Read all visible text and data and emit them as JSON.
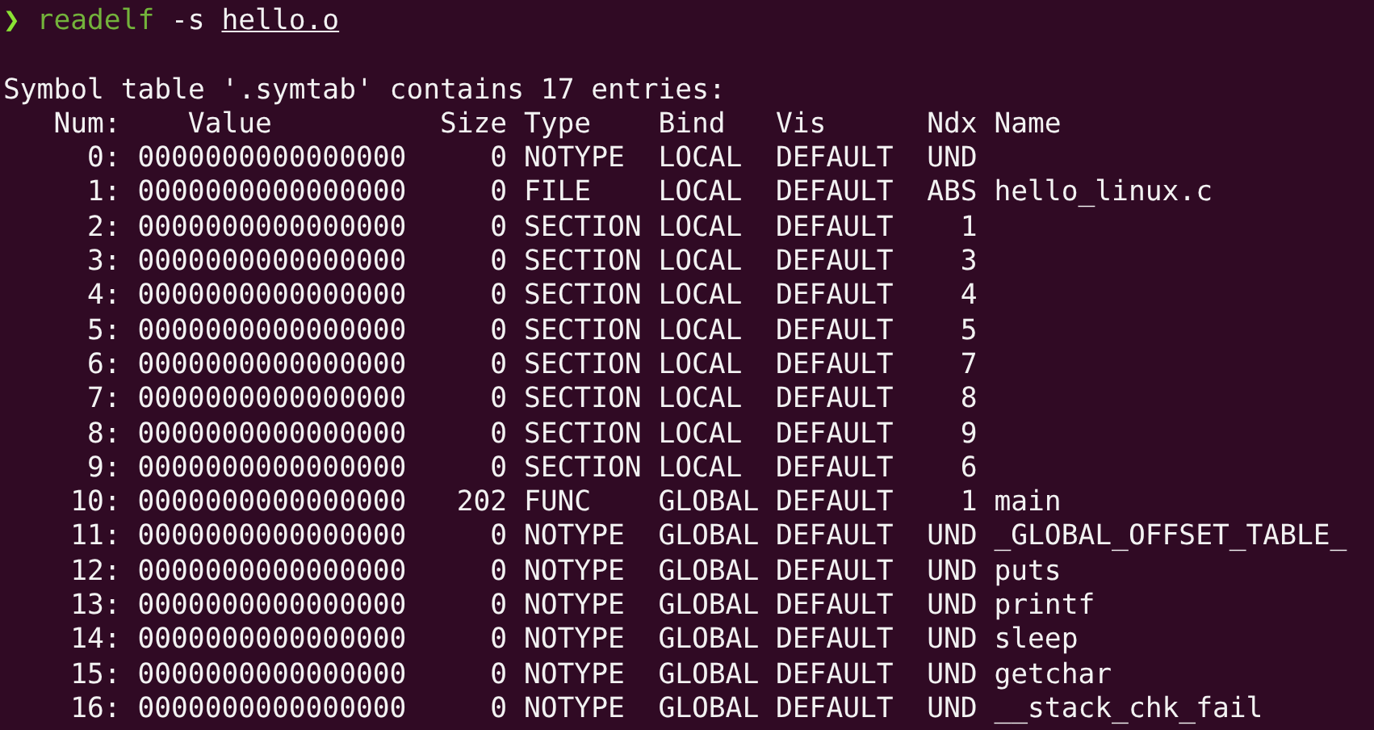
{
  "prompt": {
    "symbol": "❯",
    "command": "readelf",
    "flag": "-s",
    "file": "hello.o"
  },
  "summary": "Symbol table '.symtab' contains 17 entries:",
  "table": {
    "columns": [
      "Num:",
      "Value",
      "Size",
      "Type",
      "Bind",
      "Vis",
      "Ndx",
      "Name"
    ],
    "rows": [
      {
        "num": "0:",
        "value": "0000000000000000",
        "size": "0",
        "type": "NOTYPE",
        "bind": "LOCAL",
        "vis": "DEFAULT",
        "ndx": "UND"
      },
      {
        "num": "1:",
        "value": "0000000000000000",
        "size": "0",
        "type": "FILE",
        "bind": "LOCAL",
        "vis": "DEFAULT",
        "ndx": "ABS",
        "name": "hello_linux.c"
      },
      {
        "num": "2:",
        "value": "0000000000000000",
        "size": "0",
        "type": "SECTION",
        "bind": "LOCAL",
        "vis": "DEFAULT",
        "ndx": "1"
      },
      {
        "num": "3:",
        "value": "0000000000000000",
        "size": "0",
        "type": "SECTION",
        "bind": "LOCAL",
        "vis": "DEFAULT",
        "ndx": "3"
      },
      {
        "num": "4:",
        "value": "0000000000000000",
        "size": "0",
        "type": "SECTION",
        "bind": "LOCAL",
        "vis": "DEFAULT",
        "ndx": "4"
      },
      {
        "num": "5:",
        "value": "0000000000000000",
        "size": "0",
        "type": "SECTION",
        "bind": "LOCAL",
        "vis": "DEFAULT",
        "ndx": "5"
      },
      {
        "num": "6:",
        "value": "0000000000000000",
        "size": "0",
        "type": "SECTION",
        "bind": "LOCAL",
        "vis": "DEFAULT",
        "ndx": "7"
      },
      {
        "num": "7:",
        "value": "0000000000000000",
        "size": "0",
        "type": "SECTION",
        "bind": "LOCAL",
        "vis": "DEFAULT",
        "ndx": "8"
      },
      {
        "num": "8:",
        "value": "0000000000000000",
        "size": "0",
        "type": "SECTION",
        "bind": "LOCAL",
        "vis": "DEFAULT",
        "ndx": "9"
      },
      {
        "num": "9:",
        "value": "0000000000000000",
        "size": "0",
        "type": "SECTION",
        "bind": "LOCAL",
        "vis": "DEFAULT",
        "ndx": "6"
      },
      {
        "num": "10:",
        "value": "0000000000000000",
        "size": "202",
        "type": "FUNC",
        "bind": "GLOBAL",
        "vis": "DEFAULT",
        "ndx": "1",
        "name": "main"
      },
      {
        "num": "11:",
        "value": "0000000000000000",
        "size": "0",
        "type": "NOTYPE",
        "bind": "GLOBAL",
        "vis": "DEFAULT",
        "ndx": "UND",
        "name": "_GLOBAL_OFFSET_TABLE_"
      },
      {
        "num": "12:",
        "value": "0000000000000000",
        "size": "0",
        "type": "NOTYPE",
        "bind": "GLOBAL",
        "vis": "DEFAULT",
        "ndx": "UND",
        "name": "puts"
      },
      {
        "num": "13:",
        "value": "0000000000000000",
        "size": "0",
        "type": "NOTYPE",
        "bind": "GLOBAL",
        "vis": "DEFAULT",
        "ndx": "UND",
        "name": "printf"
      },
      {
        "num": "14:",
        "value": "0000000000000000",
        "size": "0",
        "type": "NOTYPE",
        "bind": "GLOBAL",
        "vis": "DEFAULT",
        "ndx": "UND",
        "name": "sleep"
      },
      {
        "num": "15:",
        "value": "0000000000000000",
        "size": "0",
        "type": "NOTYPE",
        "bind": "GLOBAL",
        "vis": "DEFAULT",
        "ndx": "UND",
        "name": "getchar"
      },
      {
        "num": "16:",
        "value": "0000000000000000",
        "size": "0",
        "type": "NOTYPE",
        "bind": "GLOBAL",
        "vis": "DEFAULT",
        "ndx": "UND",
        "name": "__stack_chk_fail"
      }
    ]
  }
}
